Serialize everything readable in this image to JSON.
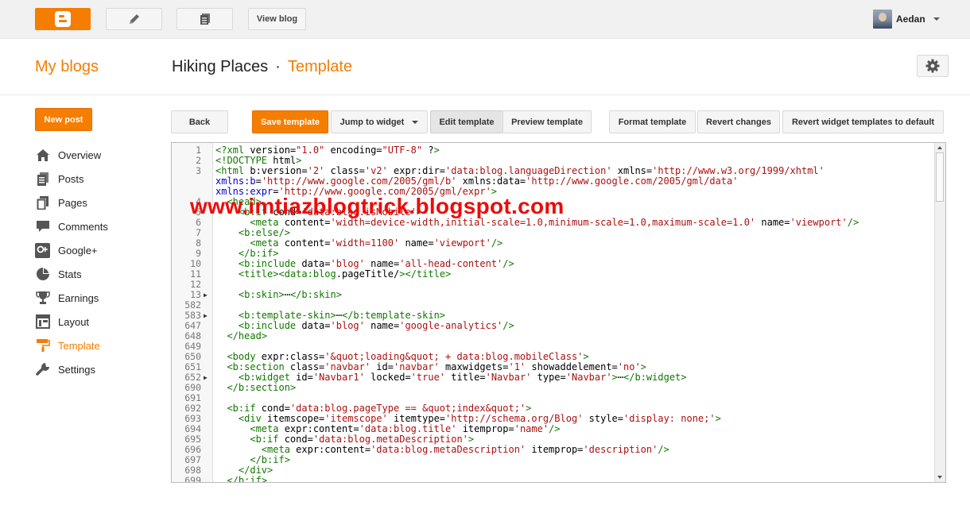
{
  "topbar": {
    "view_blog": "View blog",
    "user_name": "Aedan",
    "logo_icon": "blogger-logo-icon",
    "pen_icon": "pencil-icon",
    "pages_icon": "posts-list-icon"
  },
  "header": {
    "my_blogs": "My blogs",
    "blog_name": "Hiking Places",
    "separator": "·",
    "section": "Template"
  },
  "sidebar": {
    "new_post": "New post",
    "items": [
      {
        "label": "Overview",
        "icon": "home-icon"
      },
      {
        "label": "Posts",
        "icon": "posts-icon"
      },
      {
        "label": "Pages",
        "icon": "pages-icon"
      },
      {
        "label": "Comments",
        "icon": "comment-icon"
      },
      {
        "label": "Google+",
        "icon": "google-plus-icon"
      },
      {
        "label": "Stats",
        "icon": "pie-chart-icon"
      },
      {
        "label": "Earnings",
        "icon": "trophy-icon"
      },
      {
        "label": "Layout",
        "icon": "layout-icon"
      },
      {
        "label": "Template",
        "icon": "paint-roller-icon",
        "active": true
      },
      {
        "label": "Settings",
        "icon": "wrench-icon"
      }
    ]
  },
  "toolbar": {
    "back": "Back",
    "save_template": "Save template",
    "jump_to_widget": "Jump to widget",
    "edit_template": "Edit template",
    "preview_template": "Preview template",
    "format_template": "Format template",
    "revert_changes": "Revert changes",
    "revert_widget": "Revert widget templates to default"
  },
  "watermark": "www.imtiazblogtrick.blogspot.com",
  "colors": {
    "accent": "#f57d00",
    "watermark": "#ee0a0a"
  },
  "editor": {
    "lines": [
      {
        "n": "1",
        "t": "<?xml version=\"1.0\" encoding=\"UTF-8\" ?>"
      },
      {
        "n": "2",
        "t": "<!DOCTYPE html>"
      },
      {
        "n": "3",
        "t": "<html b:version='2' class='v2' expr:dir='data:blog.languageDirection' xmlns='http://www.w3.org/1999/xhtml'"
      },
      {
        "n": "",
        "t": "xmlns:b='http://www.google.com/2005/gml/b' xmlns:data='http://www.google.com/2005/gml/data'"
      },
      {
        "n": "",
        "t": "xmlns:expr='http://www.google.com/2005/gml/expr'>"
      },
      {
        "n": "4",
        "t": "  <head>"
      },
      {
        "n": "5",
        "t": "    <b:if cond='data:blog.isMobile'>"
      },
      {
        "n": "6",
        "t": "      <meta content='width=device-width,initial-scale=1.0,minimum-scale=1.0,maximum-scale=1.0' name='viewport'/>"
      },
      {
        "n": "7",
        "t": "    <b:else/>"
      },
      {
        "n": "8",
        "t": "      <meta content='width=1100' name='viewport'/>"
      },
      {
        "n": "9",
        "t": "    </b:if>"
      },
      {
        "n": "10",
        "t": "    <b:include data='blog' name='all-head-content'/>"
      },
      {
        "n": "11",
        "t": "    <title><data:blog.pageTitle/></title>"
      },
      {
        "n": "12",
        "t": ""
      },
      {
        "n": "13",
        "t": "    <b:skin>⋯</b:skin>",
        "fold": true
      },
      {
        "n": "582",
        "t": ""
      },
      {
        "n": "583",
        "t": "    <b:template-skin>⋯</b:template-skin>",
        "fold": true
      },
      {
        "n": "647",
        "t": "    <b:include data='blog' name='google-analytics'/>"
      },
      {
        "n": "648",
        "t": "  </head>"
      },
      {
        "n": "649",
        "t": ""
      },
      {
        "n": "650",
        "t": "  <body expr:class='&quot;loading&quot; + data:blog.mobileClass'>"
      },
      {
        "n": "651",
        "t": "  <b:section class='navbar' id='navbar' maxwidgets='1' showaddelement='no'>"
      },
      {
        "n": "652",
        "t": "    <b:widget id='Navbar1' locked='true' title='Navbar' type='Navbar'>⋯</b:widget>",
        "fold": true
      },
      {
        "n": "690",
        "t": "  </b:section>"
      },
      {
        "n": "691",
        "t": ""
      },
      {
        "n": "692",
        "t": "  <b:if cond='data:blog.pageType == &quot;index&quot;'>"
      },
      {
        "n": "693",
        "t": "    <div itemscope='itemscope' itemtype='http://schema.org/Blog' style='display: none;'>"
      },
      {
        "n": "694",
        "t": "      <meta expr:content='data:blog.title' itemprop='name'/>"
      },
      {
        "n": "695",
        "t": "      <b:if cond='data:blog.metaDescription'>"
      },
      {
        "n": "696",
        "t": "        <meta expr:content='data:blog.metaDescription' itemprop='description'/>"
      },
      {
        "n": "697",
        "t": "      </b:if>"
      },
      {
        "n": "698",
        "t": "    </div>"
      },
      {
        "n": "699",
        "t": "  </b:if>"
      }
    ]
  }
}
